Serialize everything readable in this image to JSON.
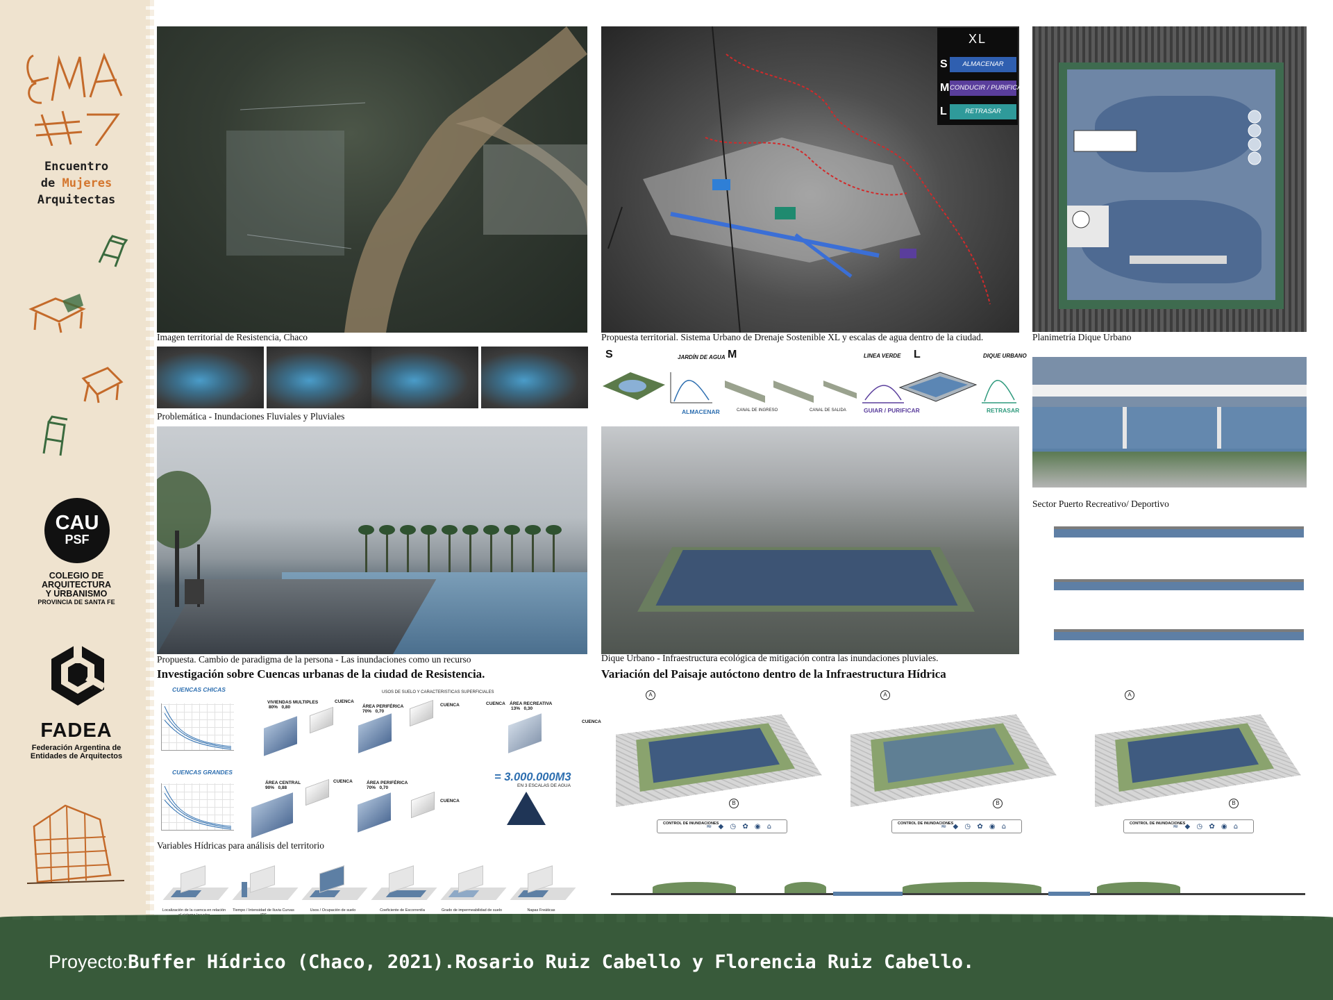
{
  "sidebar": {
    "logo_text": "EMA #7",
    "title_line1": "Encuentro",
    "title_line2_prefix": "de",
    "title_line2_highlight": "Mujeres",
    "title_line3": "Arquitectas",
    "cau_line1": "CAU",
    "cau_line2": "PSF",
    "cau_name_line1": "COLEGIO DE",
    "cau_name_line2": "ARQUITECTURA",
    "cau_name_line3": "Y URBANISMO",
    "cau_name_line4": "PROVINCIA DE SANTA FE",
    "fadea_word": "FADEA",
    "fadea_line1": "Federación Argentina de",
    "fadea_line2": "Entidades de Arquitectos"
  },
  "panels": {
    "territory_caption": "Imagen territorial de Resistencia, Chaco",
    "drainage_caption": "Propuesta territorial. Sistema Urbano de Drenaje Sostenible XL y escalas de agua dentro de la ciudad.",
    "plan_caption": "Planimetría Dique Urbano",
    "problem_caption": "Problemática - Inundaciones Fluviales y Pluviales",
    "sector_caption": "Sector Puerto Recreativo/ Deportivo",
    "plaza_caption": "Propuesta. Cambio de paradigma de la persona - Las inundaciones como un recurso",
    "dique_caption": "Dique Urbano - Infraestructura ecológica de mitigación contra las inundaciones pluviales.",
    "heading_left": "Investigación sobre Cuencas urbanas de la ciudad de Resistencia.",
    "heading_right": "Variación del Paisaje autóctono dentro de la Infraestructura Hídrica",
    "variables_caption": "Variables Hídricas para análisis del territorio"
  },
  "xl_legend": {
    "title": "XL",
    "rows": [
      {
        "key": "S",
        "label": "ALMACENAR",
        "color": "#2f5fb0"
      },
      {
        "key": "M",
        "label": "CONDUCIR / PURIFICAR",
        "color": "#5a3e9c"
      },
      {
        "key": "L",
        "label": "RETRASAR",
        "color": "#2f9a9a"
      }
    ]
  },
  "scales": {
    "s_letter": "S",
    "m_letter": "M",
    "l_letter": "L",
    "s_title": "JARDÍN DE AGUA",
    "m_title": "LINEA VERDE",
    "l_title": "DIQUE URBANO",
    "s_action": "ALMACENAR",
    "m_action": "GUIAR / PURIFICAR",
    "l_action": "RETRASAR",
    "canal_in": "CANAL DE INGRESO",
    "canal_out": "CANAL DE SALIDA"
  },
  "basins": {
    "small_title": "CUENCAS CHICAS",
    "large_title": "CUENCAS GRANDES",
    "usos_title": "USOS DE SUELO Y CARACTERISTICAS SUPERFICIALES",
    "viviendas": "VIVIENDAS MULTIPLES",
    "area_periferica": "ÁREA PERIFÉRICA",
    "area_recreativa": "ÁREA RECREATIVA",
    "area_central": "ÁREA CENTRAL",
    "cuenca": "CUENCA",
    "pct_80": "80%",
    "val_080": "0,80",
    "pct_70": "70%",
    "val_070": "0,70",
    "pct_13": "13%",
    "val_030": "0,30",
    "pct_90": "90%",
    "val_088": "0,88",
    "volume": "= 3.000.000M3",
    "volume_sub": "EN 3 ESCALAS DE AGUA"
  },
  "variables": [
    "Localización de la cuenca en relación al sistema lacustre",
    "Tiempo / Intensidad de lluvia Curvas IDF",
    "Usos / Ocupación de suelo",
    "Coeficiente de Escorrentía",
    "Grado de impermeabilidad de suelo",
    "Napas Freáticas"
  ],
  "axonometrics": {
    "marker_a": "A",
    "marker_b": "B",
    "legend_label": "CONTROL DE INUNDACIONES",
    "legend_icons": "≈ ◆ ◷ ✿ ◉ ⌂"
  },
  "footer": {
    "label": "Proyecto:",
    "text": "Buffer Hídrico (Chaco, 2021).Rosario Ruiz Cabello y Florencia Ruiz Cabello."
  },
  "colors": {
    "beige": "#efe3cf",
    "footer_green": "#385a3a",
    "accent_orange": "#d4762e",
    "water_blue": "#2e6fb0"
  }
}
